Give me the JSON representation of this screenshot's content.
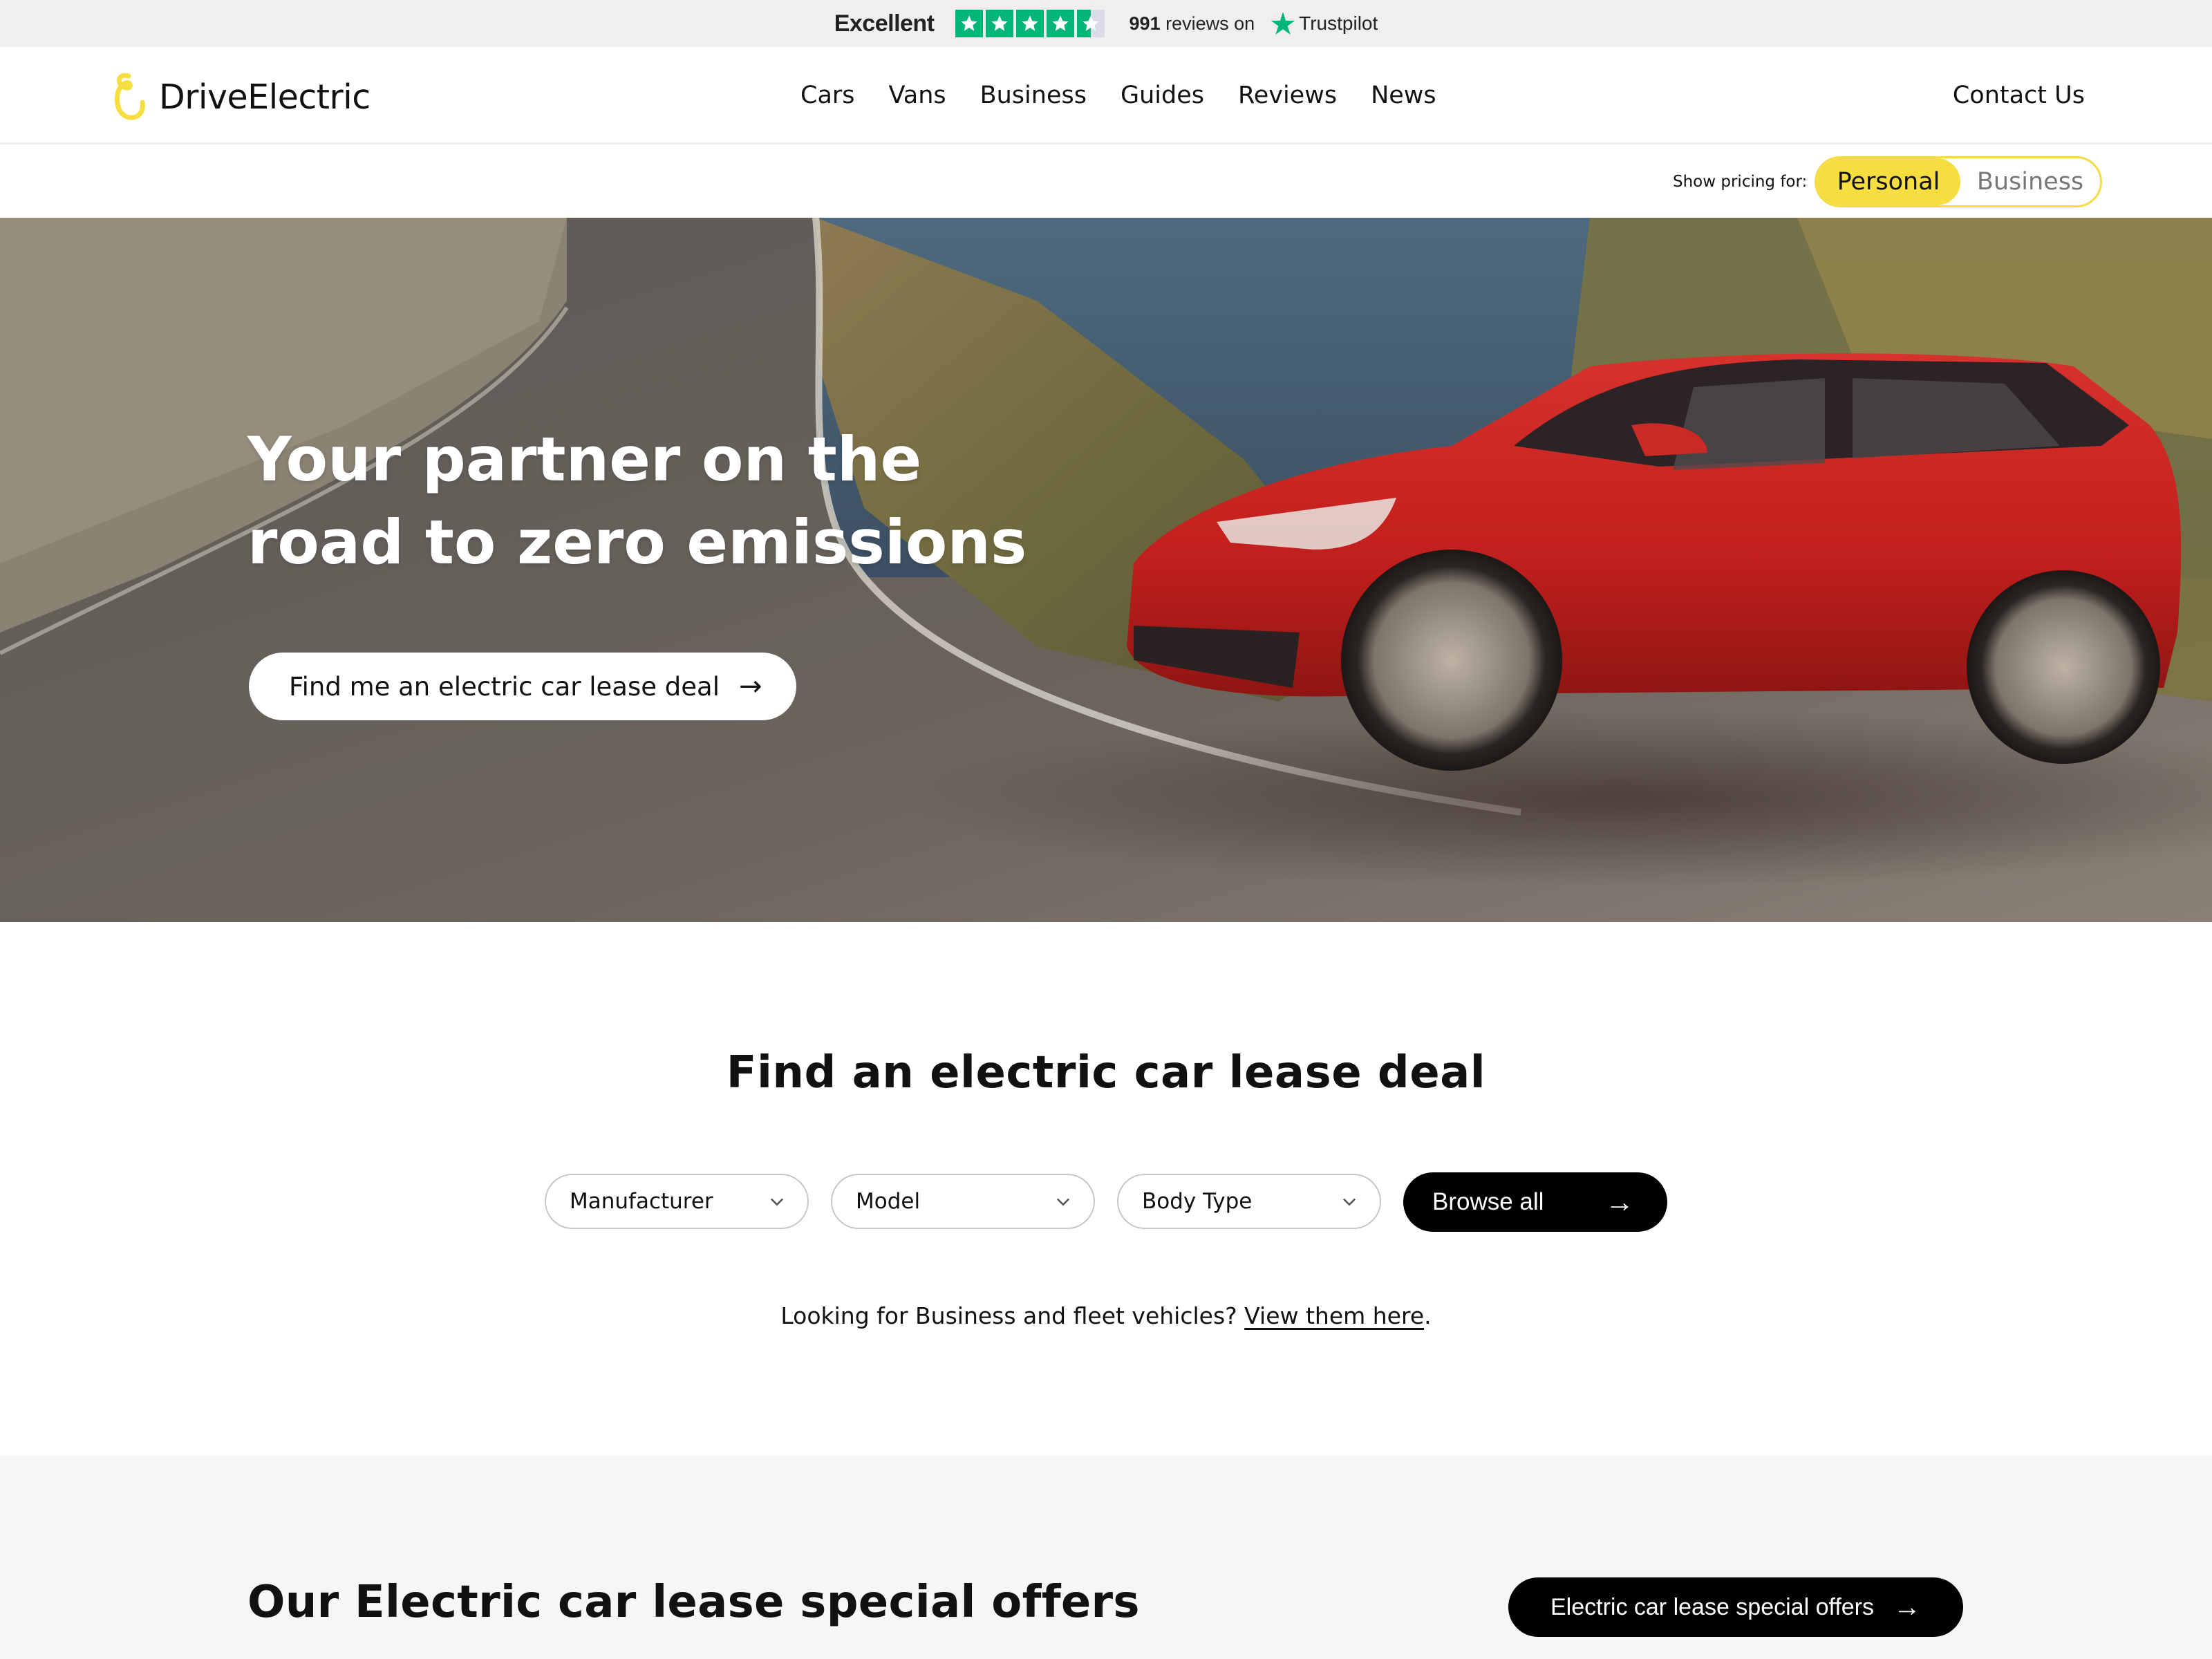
{
  "trustpilot": {
    "rating_word": "Excellent",
    "stars": 4.5,
    "review_count": "991",
    "reviews_suffix": "reviews on",
    "brand": "Trustpilot",
    "star_color": "#00b67a"
  },
  "header": {
    "logo_text": "DriveElectric",
    "logo_color": "#f7de40",
    "nav": [
      {
        "label": "Cars"
      },
      {
        "label": "Vans"
      },
      {
        "label": "Business"
      },
      {
        "label": "Guides"
      },
      {
        "label": "Reviews"
      },
      {
        "label": "News"
      }
    ],
    "contact_label": "Contact Us"
  },
  "pricing": {
    "label": "Show pricing for:",
    "options": [
      {
        "label": "Personal",
        "active": true
      },
      {
        "label": "Business",
        "active": false
      }
    ],
    "accent": "#f7de40"
  },
  "hero": {
    "title_line1": "Your partner on the",
    "title_line2": "road to zero emissions",
    "cta_label": "Find me an electric car lease deal",
    "cta_icon": "arrow-right-icon",
    "image_description": "Red electric SUV driving on a winding mountain road"
  },
  "search": {
    "title": "Find an electric car lease deal",
    "filters": [
      {
        "label": "Manufacturer",
        "icon": "chevron-down-icon"
      },
      {
        "label": "Model",
        "icon": "chevron-down-icon"
      },
      {
        "label": "Body Type",
        "icon": "chevron-down-icon"
      }
    ],
    "browse_label": "Browse all",
    "fleet_text": "Looking for Business and fleet vehicles?",
    "fleet_link": "View them here",
    "fleet_suffix": "."
  },
  "offers": {
    "title": "Our Electric car lease special offers",
    "button_label": "Electric car lease special offers"
  }
}
